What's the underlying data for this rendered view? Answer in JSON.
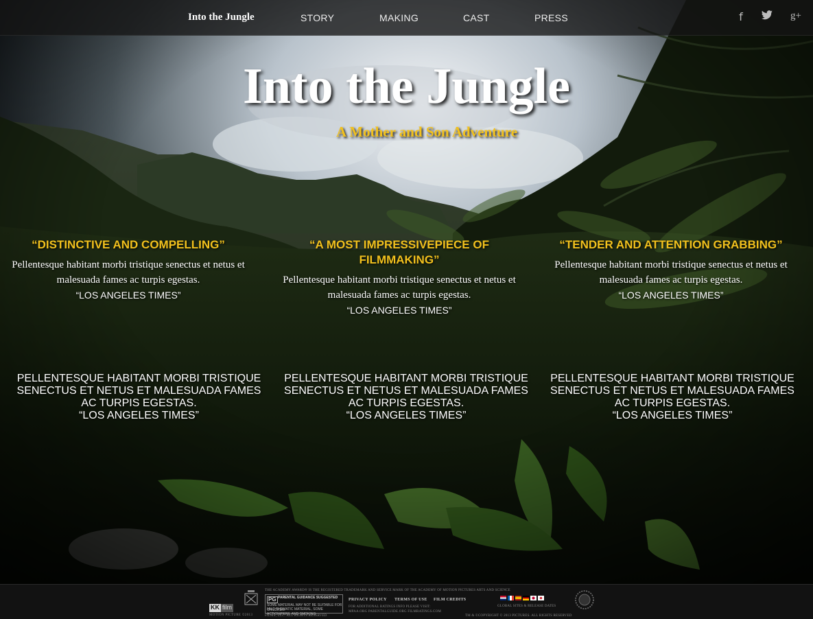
{
  "nav": {
    "brand": "Into the Jungle",
    "links": [
      "STORY",
      "MAKING",
      "CAST",
      "PRESS"
    ],
    "social": {
      "facebook": "f",
      "twitter": "🐦",
      "google_plus": "g+"
    }
  },
  "hero": {
    "title": "Into the Jungle",
    "subtitle": "A Mother and Son Adventure"
  },
  "quotes": [
    {
      "headline": "“DISTINCTIVE AND COMPELLING”",
      "body": "Pellentesque habitant morbi tristique senectus et netus et malesuada fames ac turpis egestas.",
      "source": "“LOS ANGELES TIMES”"
    },
    {
      "headline": "“A MOST IMPRESSIVEPIECE OF FILMMAKING”",
      "body": "Pellentesque habitant morbi tristique senectus et netus et malesuada fames ac turpis egestas.",
      "source": "“LOS ANGELES TIMES”"
    },
    {
      "headline": "“TENDER AND ATTENTION GRABBING”",
      "body": "Pellentesque habitant morbi tristique senectus et netus et malesuada fames ac turpis egestas.",
      "source": "“LOS ANGELES TIMES”"
    }
  ],
  "caps_quotes": [
    {
      "text": "PELLENTESQUE HABITANT MORBI TRISTIQUE SENECTUS ET NETUS ET MALESUADA FAMES AC TURPIS EGESTAS.",
      "source": "“LOS ANGELES TIMES”"
    },
    {
      "text": "PELLENTESQUE HABITANT MORBI TRISTIQUE SENECTUS ET NETUS ET MALESUADA FAMES AC TURPIS EGESTAS.",
      "source": "“LOS ANGELES TIMES”"
    },
    {
      "text": "PELLENTESQUE HABITANT MORBI TRISTIQUE SENECTUS ET NETUS ET MALESUADA FAMES AC TURPIS EGESTAS.",
      "source": "“LOS ANGELES TIMES”"
    }
  ],
  "footer": {
    "kk_logo": {
      "left": "KK",
      "right": "film"
    },
    "kk_caption": "MOTION PICTURE ©2013",
    "academy_line": "THE ACADEMY AWARD® IS THE REGISTERED TRADEMARK AND SERVICE MARK OF THE ACADEMY OF MOTION PICTURES ARTS AND SCIENCE",
    "rating": {
      "badge": "PG",
      "line1": "PARENTAL GUIDANCE SUGGESTED",
      "line2": "SOME MATERIAL MAY NOT BE SUITABLE FOR CHILDREN",
      "line3": "MILD THEMATIC MATERIAL, SOME ACTION/PERIL AND SMOKING"
    },
    "rights_line": "FILMS, LLC. ALL RIGHTS RESERVED",
    "links": [
      "PRIVACY POLICY",
      "TERMS OF USE",
      "FILM CREDITS"
    ],
    "ratings_info": "FOR ADDITIONAL RATINGS INFO PLEASE VISIT:",
    "ratings_sites": "MPAA.ORG   PARENTALGUIDE.ORG   FILMRATINGS.COM",
    "global_sites": "GLOBAL SITES & RELEASE DATES",
    "copyright": "TM & ©COPYRIGHT © 2013                PICTURES. ALL RIGHTS RESERVED",
    "colors": {
      "accent": "#f2c11d"
    }
  }
}
